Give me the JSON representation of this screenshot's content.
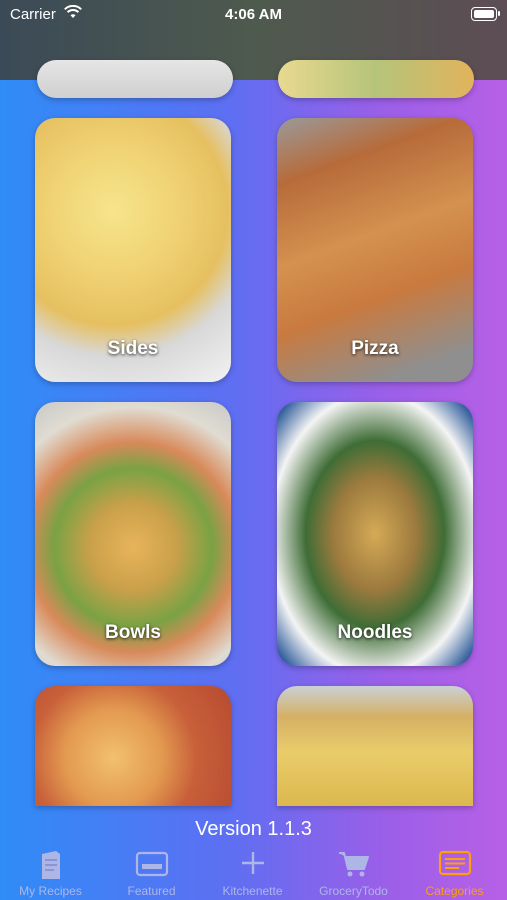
{
  "status_bar": {
    "carrier": "Carrier",
    "time": "4:06 AM"
  },
  "categories": [
    {
      "label": ""
    },
    {
      "label": ""
    },
    {
      "label": "Sides"
    },
    {
      "label": "Pizza"
    },
    {
      "label": "Bowls"
    },
    {
      "label": "Noodles"
    },
    {
      "label": ""
    },
    {
      "label": ""
    }
  ],
  "version": "Version 1.1.3",
  "tabs": [
    {
      "label": "My Recipes",
      "icon": "book-icon"
    },
    {
      "label": "Featured",
      "icon": "card-icon"
    },
    {
      "label": "Kitchenette",
      "icon": "plus-icon"
    },
    {
      "label": "GroceryTodo",
      "icon": "cart-icon"
    },
    {
      "label": "Categories",
      "icon": "categories-icon",
      "active": true
    }
  ],
  "colors": {
    "active_tab": "#ff9f0a",
    "inactive_tab": "#aeb6e6"
  }
}
